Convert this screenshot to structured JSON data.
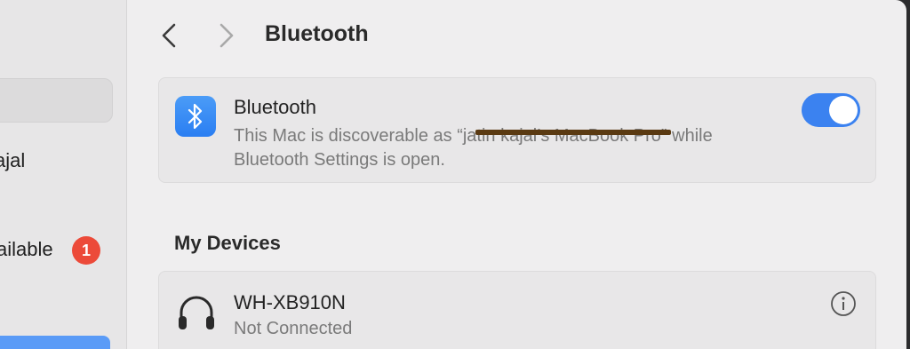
{
  "sidebar": {
    "user_partial": "ajal",
    "update_partial": "ailable",
    "update_badge": "1"
  },
  "header": {
    "title": "Bluetooth"
  },
  "bluetooth_card": {
    "title": "Bluetooth",
    "description": "This Mac is discoverable as “jatin kajal’s MacBook Pro” while Bluetooth Settings is open.",
    "enabled": true,
    "accent_color": "#3b82f0"
  },
  "my_devices": {
    "section_title": "My Devices",
    "devices": [
      {
        "name": "WH-XB910N",
        "status": "Not Connected",
        "icon": "headphones-icon"
      }
    ]
  },
  "colors": {
    "badge": "#ec4a39",
    "sidebar_selection": "#5a9bf7"
  }
}
